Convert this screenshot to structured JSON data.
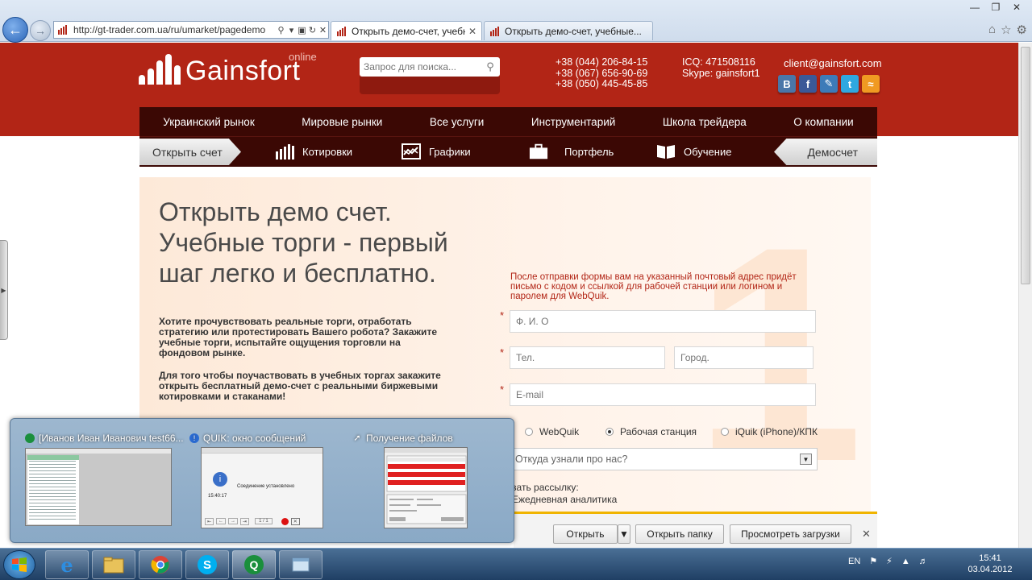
{
  "browser": {
    "url": "http://gt-trader.com.ua/ru/umarket/pagedemo",
    "tabs": [
      {
        "label": "Открыть демо-счет, учебн..."
      },
      {
        "label": "Открыть демо-счет, учебные..."
      }
    ]
  },
  "header": {
    "logo_text": "Gainsfort",
    "logo_sub": "online",
    "search_placeholder": "Запрос для поиска...",
    "phones": [
      "+38 (044) 206-84-15",
      "+38 (067) 656-90-69",
      "+38 (050) 445-45-85"
    ],
    "icq": "ICQ: 471508116",
    "skype": "Skype: gainsfort1",
    "email": "client@gainsfort.com",
    "socials": [
      "vkontakte-icon",
      "facebook-icon",
      "livejournal-icon",
      "twitter-icon",
      "rss-icon"
    ]
  },
  "nav": {
    "main": [
      "Украинский рынок",
      "Мировые рынки",
      "Все услуги",
      "Инструментарий",
      "Школа трейдера",
      "О компании"
    ],
    "open_account": "Открыть счет",
    "demo_account": "Демосчет",
    "sub": [
      {
        "label": "Котировки",
        "icon": "quotes-icon"
      },
      {
        "label": "Графики",
        "icon": "charts-icon"
      },
      {
        "label": "Портфель",
        "icon": "portfolio-icon"
      },
      {
        "label": "Обучение",
        "icon": "education-icon"
      }
    ]
  },
  "content": {
    "big_number": "1",
    "headline": "Открыть демо счет. Учебные торги - первый шаг легко и бесплатно.",
    "para1": "Хотите прочувствовать реальные торги, отработать стратегию или протестировать Вашего робота? Закажите учебные торги, испытайте ощущения торговли на фондовом рынке.",
    "para2": "Для того чтобы поучаствовать в учебных торгах закажите открыть бесплатный демо-счет с реальными биржевыми котировками и стаканами!",
    "notice": "После отправки формы вам на указанный почтовый адрес придёт письмо с кодом и ссылкой для рабочей станции или логином и паролем для WebQuik.",
    "form": {
      "required_mark": "*",
      "fio_placeholder": "Ф. И. О",
      "phone_placeholder": "Тел.",
      "city_placeholder": "Город.",
      "email_placeholder": "E-mail",
      "radios": [
        {
          "label": "WebQuik",
          "checked": false
        },
        {
          "label": "Рабочая станция",
          "checked": true
        },
        {
          "label": "iQuik (iPhone)/КПК",
          "checked": false
        }
      ],
      "source_select": "Откуда узнали про нас?",
      "subscribe_label": "казать рассылку:",
      "subscribe_option": "Ежедневная аналитика"
    }
  },
  "download_bar": {
    "open": "Открыть",
    "open_folder": "Открыть папку",
    "view_downloads": "Просмотреть загрузки"
  },
  "taskbar_preview": {
    "windows": [
      {
        "title": "[Иванов Иван Иванович test66...",
        "icon_color": "#1a8f3c"
      },
      {
        "title": "QUIK: окно сообщений",
        "icon_color": "#2b6cd4",
        "message": "Соединение установлено",
        "time": "15:40:17",
        "pager": "1 / 1"
      },
      {
        "title": "Получение файлов",
        "icon_color": "#888888"
      }
    ]
  },
  "system": {
    "lang": "EN",
    "time": "15:41",
    "date": "03.04.2012"
  },
  "colors": {
    "brand_red": "#b22516",
    "nav_dark": "#3b0804",
    "accent_yellow": "#f0b400"
  }
}
